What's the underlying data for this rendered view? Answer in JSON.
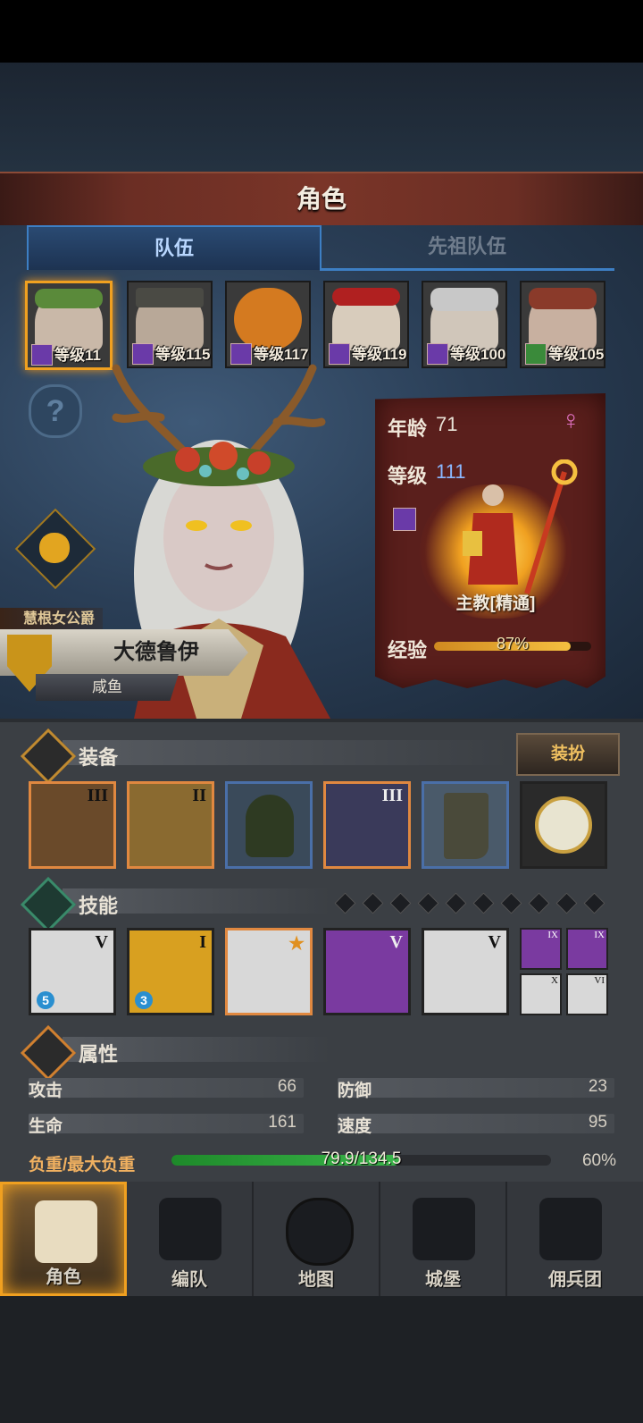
{
  "header": {
    "title": "角色"
  },
  "tabs": [
    {
      "label": "队伍",
      "active": true
    },
    {
      "label": "先祖队伍",
      "active": false
    }
  ],
  "roster": [
    {
      "level_text": "等级11",
      "selected": true,
      "face_color": "#c9b8a8",
      "hat_color": "#5a8a3a"
    },
    {
      "level_text": "等级115",
      "selected": false,
      "face_color": "#b8a898",
      "hat_color": "#4a4a44"
    },
    {
      "level_text": "等级117",
      "selected": false,
      "face_color": "#d47a20",
      "hat_color": "#a04a10"
    },
    {
      "level_text": "等级119",
      "selected": false,
      "face_color": "#d8ccbc",
      "hat_color": "#b02020"
    },
    {
      "level_text": "等级100",
      "selected": false,
      "face_color": "#d0c6ba",
      "hat_color": "#c8c8c8"
    },
    {
      "level_text": "等级105",
      "selected": false,
      "face_color": "#c8b0a0",
      "hat_color": "#8a3a2a"
    }
  ],
  "hero": {
    "title": "慧根女公爵",
    "name": "大德鲁伊",
    "nickname": "咸鱼"
  },
  "info": {
    "age_label": "年龄",
    "age_value": "71",
    "gender_symbol": "♀",
    "level_label": "等级",
    "level_value": "111",
    "role_name": "主教[精通]",
    "exp_label": "经验",
    "exp_text": "87%",
    "exp_percent": 87
  },
  "equipment": {
    "label": "装备",
    "dress_button": "装扮",
    "slots": [
      {
        "name": "weapon",
        "rank": "III",
        "border": "orange",
        "bg": "#6a4a2a"
      },
      {
        "name": "tome",
        "rank": "II",
        "border": "orange",
        "bg": "#8a6a30"
      },
      {
        "name": "hood",
        "rank": "",
        "border": "blue",
        "bg": "#3a4a5a"
      },
      {
        "name": "armor",
        "rank": "III",
        "border": "orange",
        "bg": "#3a3a5a"
      },
      {
        "name": "boots",
        "rank": "",
        "border": "blue",
        "bg": "#4a5a6a"
      },
      {
        "name": "amulet",
        "rank": "",
        "border": "dark",
        "bg": "#2a2a2a"
      }
    ]
  },
  "skills": {
    "label": "技能",
    "slots": [
      {
        "name": "spear-skill",
        "rank": "V",
        "badge": "5",
        "border": "dark",
        "bg": "#d8d8d8"
      },
      {
        "name": "holy-shield-skill",
        "rank": "I",
        "badge": "3",
        "border": "dark",
        "bg": "#d8a020"
      },
      {
        "name": "crystal-summon-skill",
        "rank": "★",
        "badge": "",
        "border": "orange",
        "bg": "#d8d8d8"
      },
      {
        "name": "crystal-hand-skill",
        "rank": "V",
        "badge": "",
        "border": "dark",
        "bg": "#7a3aa0"
      },
      {
        "name": "crystal-grab-skill",
        "rank": "V",
        "badge": "",
        "border": "dark",
        "bg": "#d8d8d8"
      }
    ],
    "mini": [
      {
        "name": "mini-skill-spear",
        "rank": "IX",
        "bg": "#7a3aa0"
      },
      {
        "name": "mini-skill-sun",
        "rank": "IX",
        "bg": "#7a3aa0"
      },
      {
        "name": "mini-skill-burst",
        "rank": "X",
        "bg": "#d8d8d8"
      },
      {
        "name": "mini-skill-star",
        "rank": "VI",
        "bg": "#d8d8d8"
      }
    ]
  },
  "attributes": {
    "label": "属性",
    "attack_label": "攻击",
    "attack_value": "66",
    "defense_label": "防御",
    "defense_value": "23",
    "hp_label": "生命",
    "hp_value": "161",
    "speed_label": "速度",
    "speed_value": "95",
    "load_label": "负重/最大负重",
    "load_text": "79.9/134.5",
    "load_percent_text": "60%",
    "load_fraction": 0.6
  },
  "nav": [
    {
      "label": "角色",
      "active": true
    },
    {
      "label": "编队",
      "active": false
    },
    {
      "label": "地图",
      "active": false
    },
    {
      "label": "城堡",
      "active": false
    },
    {
      "label": "佣兵团",
      "active": false
    }
  ],
  "colors": {
    "accent": "#f0a020",
    "tab_blue": "#3d7fc4",
    "level_blue": "#8ab8ff",
    "gender_pink": "#e070c0"
  }
}
